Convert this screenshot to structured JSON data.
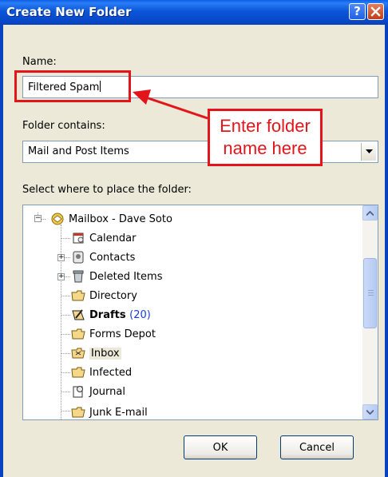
{
  "window": {
    "title": "Create New Folder",
    "help_label": "?",
    "close_label": "✕"
  },
  "form": {
    "name_label": "Name:",
    "name_value": "Filtered Spam",
    "contains_label": "Folder contains:",
    "contains_value": "Mail and Post Items",
    "place_label": "Select where to place the folder:"
  },
  "tree": {
    "root": "Mailbox - Dave Soto",
    "items": [
      {
        "label": "Calendar",
        "icon": "calendar-icon"
      },
      {
        "label": "Contacts",
        "icon": "contacts-icon",
        "expandable": true
      },
      {
        "label": "Deleted Items",
        "icon": "deleted-items-icon",
        "expandable": true
      },
      {
        "label": "Directory",
        "icon": "folder-icon"
      },
      {
        "label": "Drafts",
        "count": "(20)",
        "icon": "drafts-icon",
        "bold": true
      },
      {
        "label": "Forms Depot",
        "icon": "folder-icon"
      },
      {
        "label": "Inbox",
        "icon": "inbox-icon",
        "selected": true
      },
      {
        "label": "Infected",
        "icon": "folder-icon"
      },
      {
        "label": "Journal",
        "icon": "journal-icon"
      },
      {
        "label": "Junk E-mail",
        "icon": "junk-icon"
      }
    ]
  },
  "buttons": {
    "ok": "OK",
    "cancel": "Cancel"
  },
  "annotation": {
    "line1": "Enter folder",
    "line2": "name here",
    "color": "#e3151b"
  },
  "colors": {
    "title_bar": "#0a56d8",
    "dialog_bg": "#ece9d8",
    "count_blue": "#1a3dd6"
  }
}
